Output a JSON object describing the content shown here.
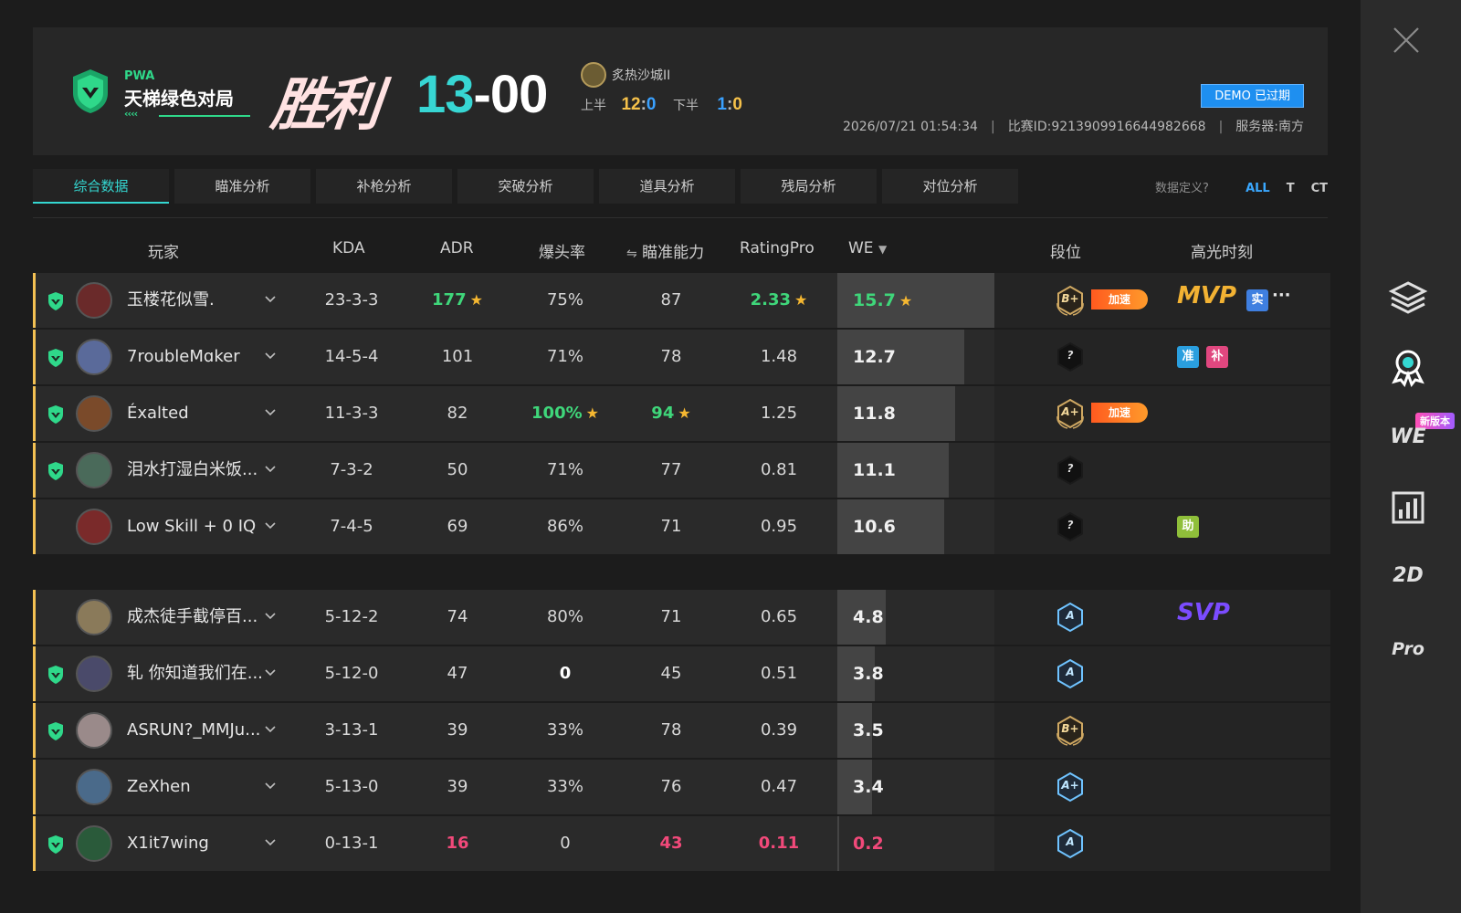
{
  "header": {
    "logo_pwa": "PWA",
    "logo_title": "天梯绿色对局",
    "logo_arrows": "‹‹‹‹",
    "result": "胜利",
    "score_team1": "13",
    "score_sep": "-",
    "score_team2": "00",
    "map_name": "炙热沙城II",
    "first_half_label": "上半",
    "first_half_t1": "12",
    "first_half_t2": "0",
    "second_half_label": "下半",
    "second_half_t1": "1",
    "second_half_t2": "0",
    "half_colon": ":",
    "demo_badge": "DEMO 已过期",
    "datetime": "2026/07/21 01:54:34",
    "match_id": "比赛ID:9213909916644982668",
    "server": "服务器:南方",
    "pipe": "|"
  },
  "tabs": [
    "综合数据",
    "瞄准分析",
    "补枪分析",
    "突破分析",
    "道具分析",
    "残局分析",
    "对位分析"
  ],
  "filter": {
    "question": "数据定义?",
    "options": [
      "ALL",
      "T",
      "CT"
    ],
    "active": "ALL"
  },
  "columns": {
    "player": "玩家",
    "kda": "KDA",
    "adr": "ADR",
    "hs": "爆头率",
    "aim_icon": "⇋",
    "aim": "瞄准能力",
    "rating": "RatingPro",
    "we": "WE",
    "we_sort": "▼",
    "rank": "段位",
    "highlight": "高光时刻"
  },
  "colors": {
    "accent_teal": "#34d7d1",
    "green": "#3fd67a",
    "red": "#f2497a",
    "gold": "#f3c153",
    "blue": "#1e8ff0"
  },
  "star": "★",
  "fire_label": "加速",
  "team1": [
    {
      "name": "玉楼花似雪.",
      "verified": true,
      "kda": "23-3-3",
      "adr": "177",
      "adr_star": true,
      "adr_style": "green",
      "hs": "75%",
      "hs_style": "",
      "aim": "87",
      "aim_style": "",
      "rating": "2.33",
      "rating_style": "green",
      "rating_star": true,
      "we": "15.7",
      "we_level": 1.0,
      "we_style": "green",
      "we_star": true,
      "rank": "B+",
      "rank_type": "gold",
      "fire": true,
      "highlight": "MVP",
      "tags": [
        {
          "t": "实",
          "c": "blue"
        }
      ],
      "more": "···"
    },
    {
      "name": "7roubleMɑker",
      "verified": true,
      "kda": "14-5-4",
      "adr": "101",
      "hs": "71%",
      "aim": "78",
      "rating": "1.48",
      "we": "12.7",
      "we_level": 0.81,
      "rank": "?",
      "rank_type": "dark",
      "tags": [
        {
          "t": "准",
          "c": "cyan"
        },
        {
          "t": "补",
          "c": "pink"
        }
      ]
    },
    {
      "name": "Éxalted",
      "verified": true,
      "kda": "11-3-3",
      "adr": "82",
      "hs": "100%",
      "hs_style": "green",
      "hs_star": true,
      "aim": "94",
      "aim_style": "green",
      "aim_star": true,
      "rating": "1.25",
      "we": "11.8",
      "we_level": 0.75,
      "rank": "A+",
      "rank_type": "gold",
      "fire": true,
      "tags": []
    },
    {
      "name": "泪水打湿白米饭...",
      "verified": true,
      "kda": "7-3-2",
      "adr": "50",
      "hs": "71%",
      "aim": "77",
      "rating": "0.81",
      "we": "11.1",
      "we_level": 0.71,
      "rank": "?",
      "rank_type": "dark",
      "tags": []
    },
    {
      "name": "Low Skill + 0 IQ",
      "verified": false,
      "kda": "7-4-5",
      "adr": "69",
      "hs": "86%",
      "aim": "71",
      "rating": "0.95",
      "we": "10.6",
      "we_level": 0.68,
      "rank": "?",
      "rank_type": "dark",
      "tags": [
        {
          "t": "助",
          "c": "lime"
        }
      ]
    }
  ],
  "team2": [
    {
      "name": "成杰徒手截停百...",
      "verified": false,
      "kda": "5-12-2",
      "adr": "74",
      "hs": "80%",
      "aim": "71",
      "rating": "0.65",
      "we": "4.8",
      "we_level": 0.31,
      "rank": "A",
      "rank_type": "blue",
      "highlight": "SVP",
      "tags": []
    },
    {
      "name": "轧 你知道我们在...",
      "verified": true,
      "kda": "5-12-0",
      "adr": "47",
      "hs": "0",
      "hs_style": "white",
      "aim": "45",
      "rating": "0.51",
      "we": "3.8",
      "we_level": 0.24,
      "rank": "A",
      "rank_type": "blue",
      "tags": []
    },
    {
      "name": "ASRUN?_MMJu...",
      "verified": true,
      "kda": "3-13-1",
      "adr": "39",
      "hs": "33%",
      "aim": "78",
      "rating": "0.39",
      "we": "3.5",
      "we_level": 0.22,
      "rank": "B+",
      "rank_type": "gold",
      "tags": []
    },
    {
      "name": "ZeXhen",
      "verified": false,
      "kda": "5-13-0",
      "adr": "39",
      "hs": "33%",
      "aim": "76",
      "rating": "0.47",
      "we": "3.4",
      "we_level": 0.22,
      "rank": "A+",
      "rank_type": "blue",
      "tags": []
    },
    {
      "name": "X1it7wing",
      "verified": true,
      "kda": "0-13-1",
      "adr": "16",
      "adr_style": "red",
      "hs": "0",
      "aim": "43",
      "aim_style": "red",
      "rating": "0.11",
      "rating_style": "red",
      "we": "0.2",
      "we_level": 0.01,
      "we_style": "red",
      "rank": "A",
      "rank_type": "blue",
      "tags": []
    }
  ],
  "sidebar": {
    "new_badge": "新版本",
    "we_label": "WE",
    "label_2d": "2D",
    "label_pro": "Pro"
  }
}
